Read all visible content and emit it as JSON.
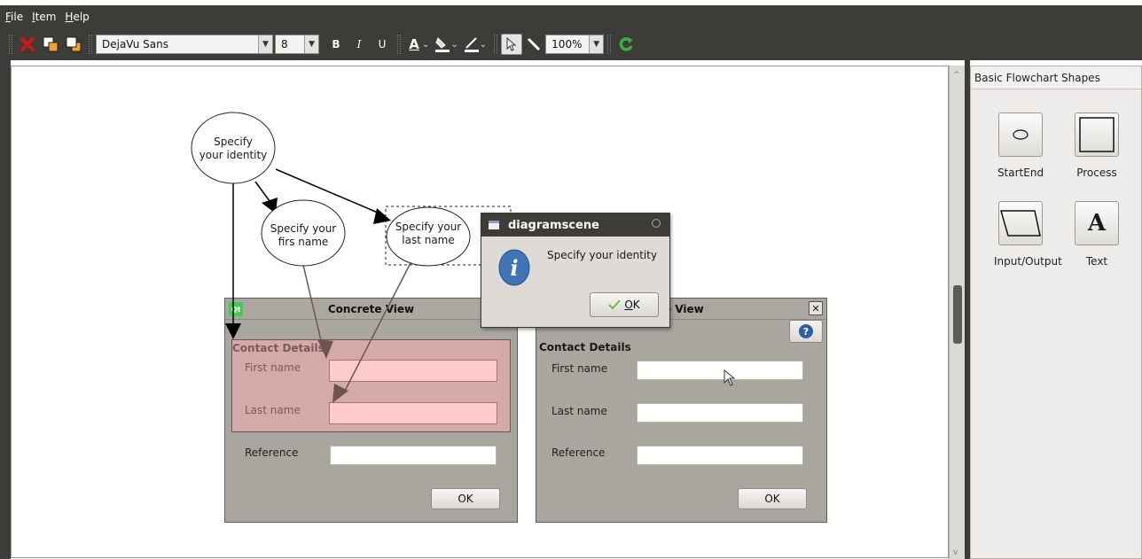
{
  "menu": [
    {
      "mnemonic": "F",
      "rest": "ile"
    },
    {
      "mnemonic": "I",
      "rest": "tem"
    },
    {
      "mnemonic": "H",
      "rest": "elp"
    }
  ],
  "toolbar": {
    "font_family": "DejaVu Sans",
    "font_size": "8",
    "bold": "B",
    "italic": "I",
    "underline": "U",
    "text_color_glyph": "A",
    "zoom": "100%",
    "icons": [
      "delete-icon",
      "bring-to-front-icon",
      "send-to-back-icon",
      "text-color-icon",
      "fill-color-icon",
      "line-color-icon",
      "pointer-icon",
      "line-tool-icon",
      "refresh-icon"
    ]
  },
  "sidebar": {
    "title": "Basic Flowchart Shapes",
    "tools": [
      {
        "label": "StartEnd",
        "icon": "ellipse-icon"
      },
      {
        "label": "Process",
        "icon": "rectangle-icon"
      },
      {
        "label": "Input/Output",
        "icon": "parallelogram-icon"
      },
      {
        "label": "Text",
        "icon": "text-icon",
        "glyph": "A"
      }
    ]
  },
  "diagram": {
    "nodes": [
      {
        "line1": "Specify",
        "line2": "your identity"
      },
      {
        "line1": "Specify your",
        "line2": "firs name"
      },
      {
        "line1": "Specify your",
        "line2": "last name"
      }
    ]
  },
  "dialog_left": {
    "title": "Concrete View",
    "qt_badge": "Qt",
    "group": "Contact Details",
    "labels": [
      "First name",
      "Last name",
      "Reference"
    ],
    "ok": "OK"
  },
  "dialog_right": {
    "title": "te View",
    "group": "Contact Details",
    "labels": [
      "First name",
      "Last name",
      "Reference"
    ],
    "ok": "OK"
  },
  "messagebox": {
    "title": "diagramscene",
    "text": "Specify your identity",
    "ok_mnemonic": "O",
    "ok_rest": "K"
  },
  "colors": {
    "chrome": "#3e3c39",
    "dialog_bg": "#a9a59f",
    "highlight": "#d4a9a9",
    "field_pink": "#ffcccc",
    "arrow_dark": "#000000",
    "arrow_brown": "#6e5353"
  }
}
